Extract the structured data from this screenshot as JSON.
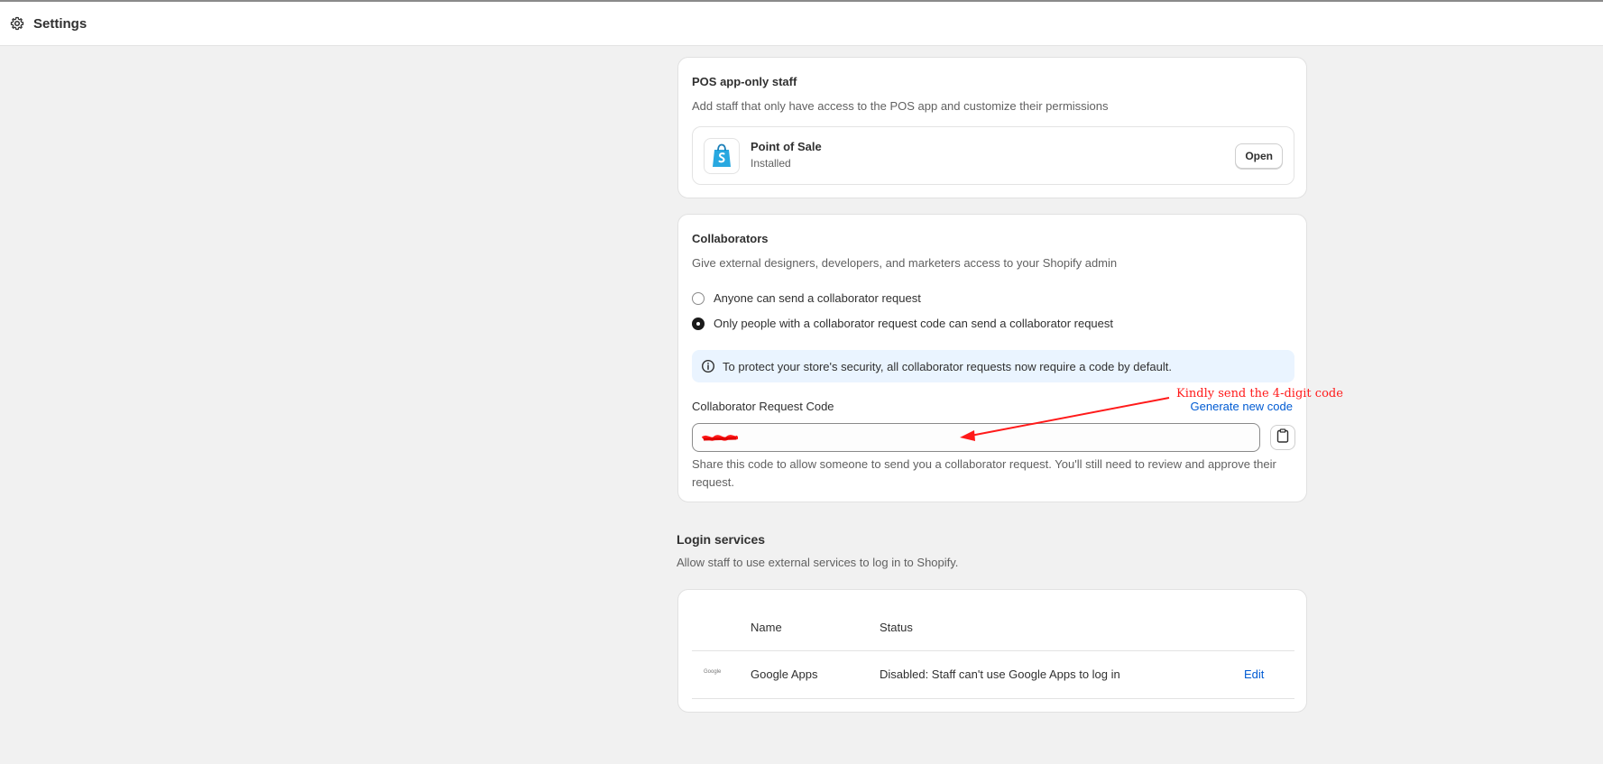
{
  "header": {
    "title": "Settings",
    "icon": "gear-icon"
  },
  "pos_card": {
    "title": "POS app-only staff",
    "description": "Add staff that only have access to the POS app and customize their permissions",
    "app": {
      "name": "Point of Sale",
      "status": "Installed",
      "button_label": "Open",
      "icon": "shopify-bag-icon"
    }
  },
  "collaborators": {
    "title": "Collaborators",
    "description": "Give external designers, developers, and marketers access to your Shopify admin",
    "options": [
      {
        "label": "Anyone can send a collaborator request",
        "selected": false
      },
      {
        "label": "Only people with a collaborator request code can send a collaborator request",
        "selected": true
      }
    ],
    "info_banner": "To protect your store's security, all collaborator requests now require a code by default.",
    "code_label": "Collaborator Request Code",
    "generate_link": "Generate new code",
    "help_text": "Share this code to allow someone to send you a collaborator request. You'll still need to review and approve their request.",
    "copy_icon": "clipboard-icon"
  },
  "login_services": {
    "title": "Login services",
    "description": "Allow staff to use external services to log in to Shopify.",
    "columns": [
      "Name",
      "Status"
    ],
    "rows": [
      {
        "logo_text": "Google",
        "name": "Google Apps",
        "status": "Disabled: Staff can't use Google Apps to log in",
        "action": "Edit"
      }
    ]
  },
  "annotation": {
    "text": "Kindly send the 4-digit code",
    "color": "#ff1a1a"
  },
  "colors": {
    "accent_link": "#005bd3",
    "info_background": "#eaf4ff",
    "page_background": "#f1f1f1"
  }
}
